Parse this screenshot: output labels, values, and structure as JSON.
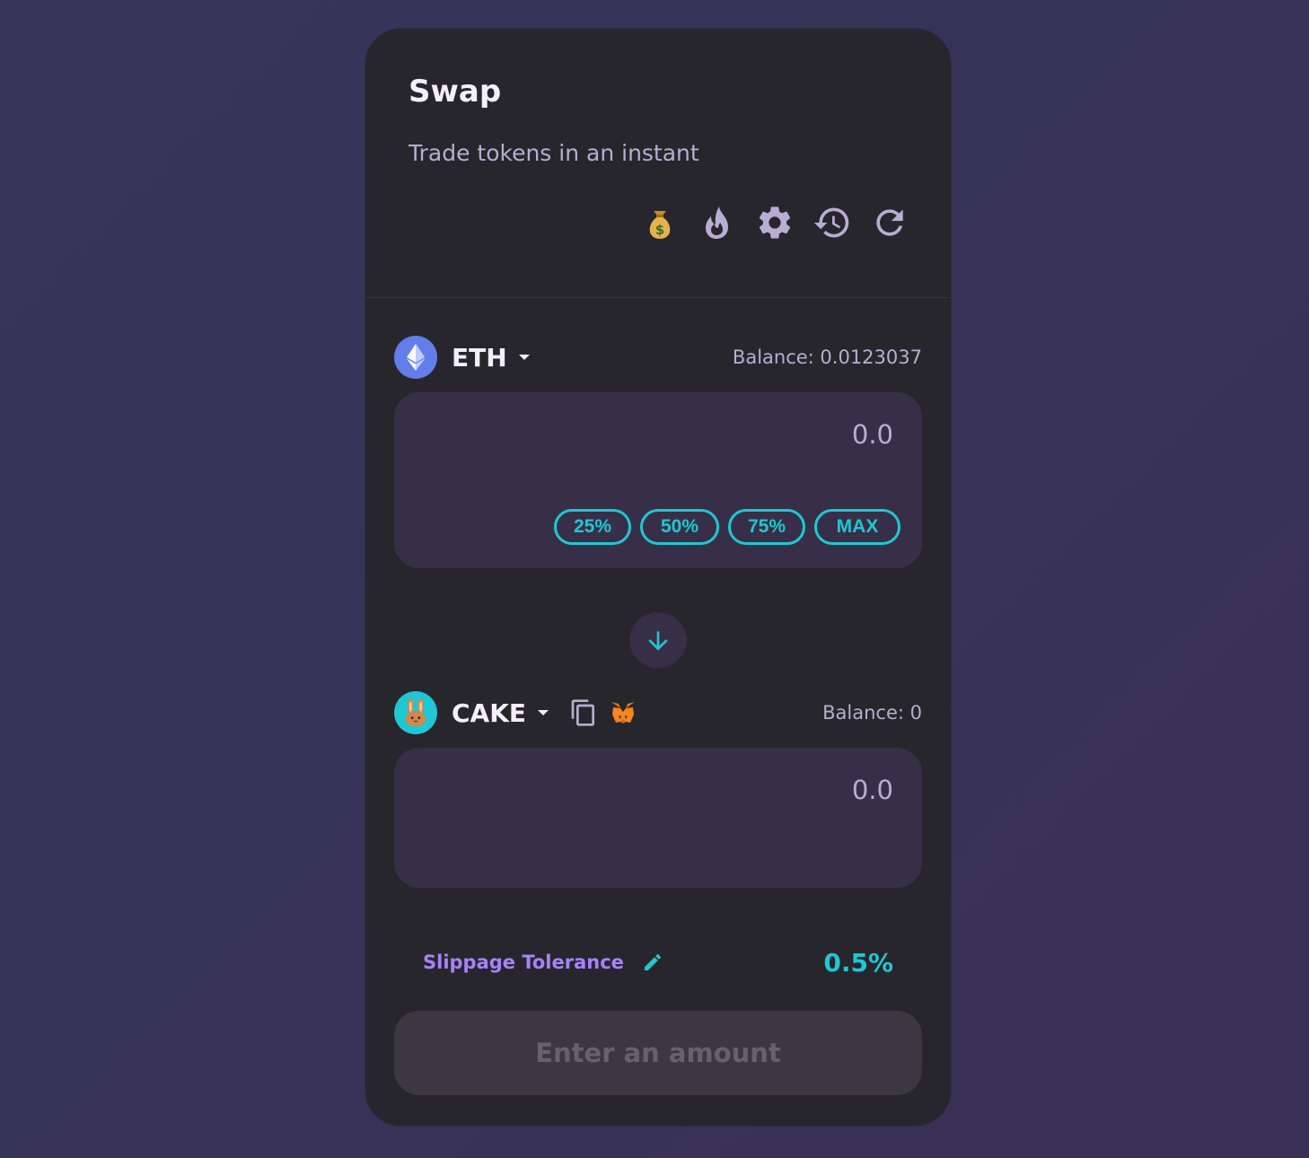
{
  "header": {
    "title": "Swap",
    "subtitle": "Trade tokens in an instant",
    "icons": [
      "money-bag-icon",
      "flame-icon",
      "gear-icon",
      "history-icon",
      "refresh-icon"
    ]
  },
  "from": {
    "token": "ETH",
    "balance": "Balance: 0.0123037",
    "amount_placeholder": "0.0",
    "percent_buttons": [
      "25%",
      "50%",
      "75%",
      "MAX"
    ]
  },
  "to": {
    "token": "CAKE",
    "balance": "Balance: 0",
    "amount_placeholder": "0.0"
  },
  "slippage": {
    "label": "Slippage Tolerance",
    "value": "0.5%"
  },
  "cta": {
    "label": "Enter an amount"
  },
  "colors": {
    "accent_teal": "#1fc7d4",
    "accent_purple": "#a881fc",
    "card_bg": "#27262c",
    "input_bg": "#372f47",
    "text_primary": "#f4eeff",
    "text_secondary": "#b8add2"
  }
}
